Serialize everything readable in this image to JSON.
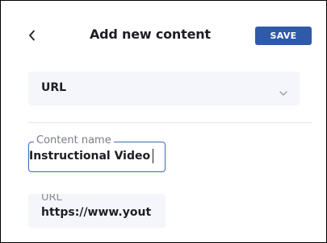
{
  "header": {
    "title": "Add new content",
    "save_label": "SAVE",
    "back_icon": "chevron-left-icon"
  },
  "content_type_select": {
    "selected": "URL",
    "icon": "chevron-down-icon"
  },
  "content_name_field": {
    "label": "Content name",
    "value": "Instructional Video"
  },
  "url_field": {
    "label": "URL",
    "value": "https://www.yout"
  },
  "colors": {
    "accent": "#2f5aa8",
    "field_background": "#f5f6fb",
    "text": "#1d1d24"
  }
}
